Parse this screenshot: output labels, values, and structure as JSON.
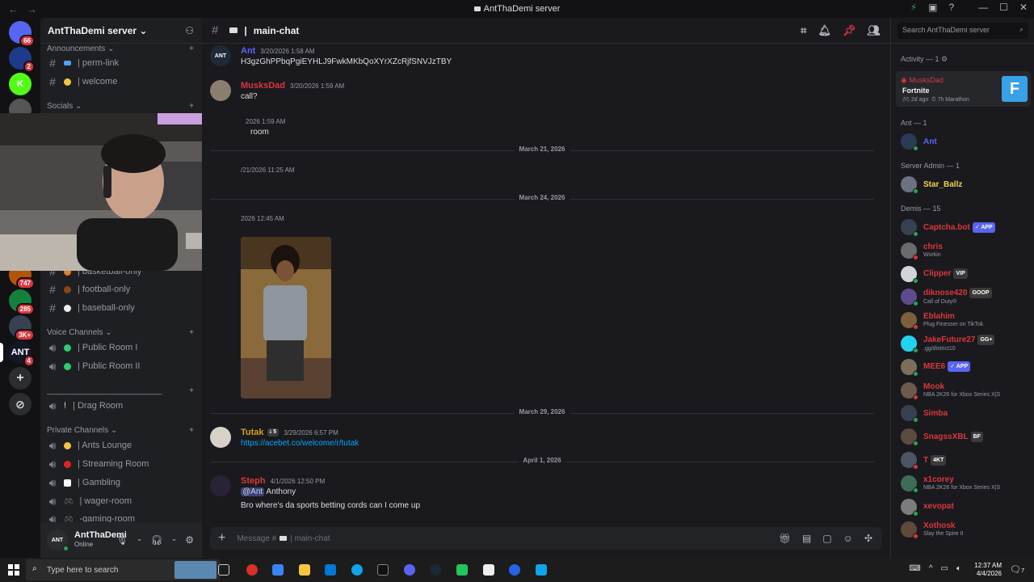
{
  "window": {
    "title": "AntThaDemi server"
  },
  "guilds": {
    "items": [
      {
        "label": "",
        "badge": "66",
        "color": "#5865f2"
      },
      {
        "label": "",
        "badge": "2",
        "color": "#1e3a8a"
      },
      {
        "label": "K",
        "badge": "",
        "color": "#53fc18"
      },
      {
        "label": "",
        "badge": "",
        "color": "#555"
      },
      {
        "label": "",
        "badge": "747",
        "color": "#b45309"
      },
      {
        "label": "",
        "badge": "285",
        "color": "#15803d"
      },
      {
        "label": "",
        "badge": "3K+",
        "color": "#374151"
      },
      {
        "label": "ANT",
        "badge": "4",
        "color": "#111827"
      }
    ],
    "add_label": "+",
    "discover_label": "⊘"
  },
  "server": {
    "name": "AntThaDemi server"
  },
  "channels": {
    "categories": {
      "announcements": "Announcements",
      "socials": "Socials",
      "voice": "Voice Channels",
      "private": "Private Channels",
      "separator": "_______________________________"
    },
    "announcements": [
      {
        "emoji_color": "#4ea1ff",
        "name": "| perm-link"
      },
      {
        "emoji_color": "#f5c542",
        "name": "| welcome"
      }
    ],
    "sports": [
      {
        "emoji_color": "#e67e22",
        "name": "| basketball-only"
      },
      {
        "emoji_color": "#8b4513",
        "name": "| football-only"
      },
      {
        "emoji_color": "#eeeeee",
        "name": "| baseball-only"
      }
    ],
    "voice": [
      {
        "emoji_color": "#2ecc71",
        "name": "| Public Room I"
      },
      {
        "emoji_color": "#2ecc71",
        "name": "| Public Room II"
      }
    ],
    "drag": {
      "name": "| Drag Room"
    },
    "private": [
      {
        "emoji_color": "#f5c542",
        "name": "| Ants Lounge"
      },
      {
        "emoji_color": "#e02424",
        "name": "| Streaming Room"
      },
      {
        "emoji_color": "#ffffff",
        "name": "| Gambling"
      },
      {
        "emoji_color": "#888888",
        "name": "| wager-room"
      },
      {
        "emoji_color": "#888888",
        "name": "-gaming-room"
      }
    ]
  },
  "user_panel": {
    "name": "AntThaDemi",
    "status": "Online"
  },
  "chat": {
    "channel_name": "main-chat",
    "messages": [
      {
        "author": "Ant",
        "color": "#5865f2",
        "time": "3/20/2026 1:58 AM",
        "text": "H3gzGhPPbqPgiEYHLJ9FwkMKbQoXYrXZcRjfSNVJzTBY"
      },
      {
        "author": "MusksDad",
        "color": "#da373c",
        "time": "3/20/2026 1:59 AM",
        "text": "call?"
      },
      {
        "author": "",
        "color": "#da373c",
        "time": "2026 1:59 AM",
        "text": "room"
      },
      {
        "author": "",
        "color": "#da373c",
        "time": "/21/2026 11:25 AM",
        "text": ""
      },
      {
        "author": "",
        "color": "#da373c",
        "time": "2026 12:45 AM",
        "text": ""
      },
      {
        "author": "Tutak",
        "color": "#d4a017",
        "time": "3/29/2026 6:57 PM",
        "text": "https://acebet.co/welcome/r/tutak",
        "tag": "5"
      },
      {
        "author": "Steph",
        "color": "#da373c",
        "time": "4/1/2026 12:50 PM",
        "mention": "@Ant",
        "text_after_mention": "Anthony",
        "text2": "Bro where's da sports betting cords can I come up"
      }
    ],
    "dividers": [
      "March 21, 2026",
      "March 24, 2026",
      "March 29, 2026",
      "April 1, 2026"
    ],
    "composer_placeholder": "Message #",
    "composer_channel": "main-chat"
  },
  "members": {
    "search_placeholder": "Search AntThaDemi server",
    "activity_header": "Activity — 1",
    "activity": {
      "name": "MusksDad",
      "game": "Fortnite",
      "detail1": "2d ago",
      "detail2": "7h Marathon"
    },
    "groups": [
      {
        "label": "Ant — 1",
        "members": [
          {
            "name": "Ant",
            "color": "#5865f2",
            "sub": "",
            "tag": "",
            "tag_color": ""
          }
        ]
      },
      {
        "label": "Server Admin — 1",
        "members": [
          {
            "name": "Star_Ballz",
            "color": "#f0d24b",
            "sub": "",
            "tag": "",
            "tag_color": ""
          }
        ]
      },
      {
        "label": "Demis — 15",
        "members": [
          {
            "name": "Captcha.bot",
            "color": "#da373c",
            "sub": "",
            "tag": "✓ APP",
            "tag_color": "#5865f2"
          },
          {
            "name": "chris",
            "color": "#da373c",
            "sub": "Workin",
            "tag": "",
            "tag_color": ""
          },
          {
            "name": "Clipper",
            "color": "#da373c",
            "sub": "",
            "tag": "VIP",
            "tag_color": "#3a3a3a"
          },
          {
            "name": "diknose420",
            "color": "#da373c",
            "sub": "Call of Duty®",
            "tag": "GOOP",
            "tag_color": "#3a3a3a"
          },
          {
            "name": "Eblahim",
            "color": "#da373c",
            "sub": "Plug Finesser on TikTok",
            "tag": "",
            "tag_color": ""
          },
          {
            "name": "JakeFuture27",
            "color": "#da373c",
            "sub": ".gg/district10",
            "tag": "GG+",
            "tag_color": "#3a3a3a"
          },
          {
            "name": "MEE6",
            "color": "#da373c",
            "sub": "",
            "tag": "✓ APP",
            "tag_color": "#5865f2"
          },
          {
            "name": "Mook",
            "color": "#da373c",
            "sub": "NBA 2K26 for Xbox Series X|S",
            "tag": "",
            "tag_color": ""
          },
          {
            "name": "Simba",
            "color": "#da373c",
            "sub": "",
            "tag": "",
            "tag_color": ""
          },
          {
            "name": "SnagssXBL",
            "color": "#da373c",
            "sub": "",
            "tag": "BF",
            "tag_color": "#3a3a3a"
          },
          {
            "name": "T",
            "color": "#da373c",
            "sub": "",
            "tag": "4KT",
            "tag_color": "#3a3a3a"
          },
          {
            "name": "x1corey",
            "color": "#da373c",
            "sub": "NBA 2K26 for Xbox Series X|S",
            "tag": "",
            "tag_color": ""
          },
          {
            "name": "xevopat",
            "color": "#da373c",
            "sub": "",
            "tag": "",
            "tag_color": ""
          },
          {
            "name": "Xothosk",
            "color": "#da373c",
            "sub": "Slay the Spire II",
            "tag": "",
            "tag_color": ""
          }
        ]
      }
    ]
  },
  "taskbar": {
    "search_placeholder": "Type here to search",
    "time": "12:37 AM",
    "date": "4/4/2026",
    "notif": "7"
  }
}
